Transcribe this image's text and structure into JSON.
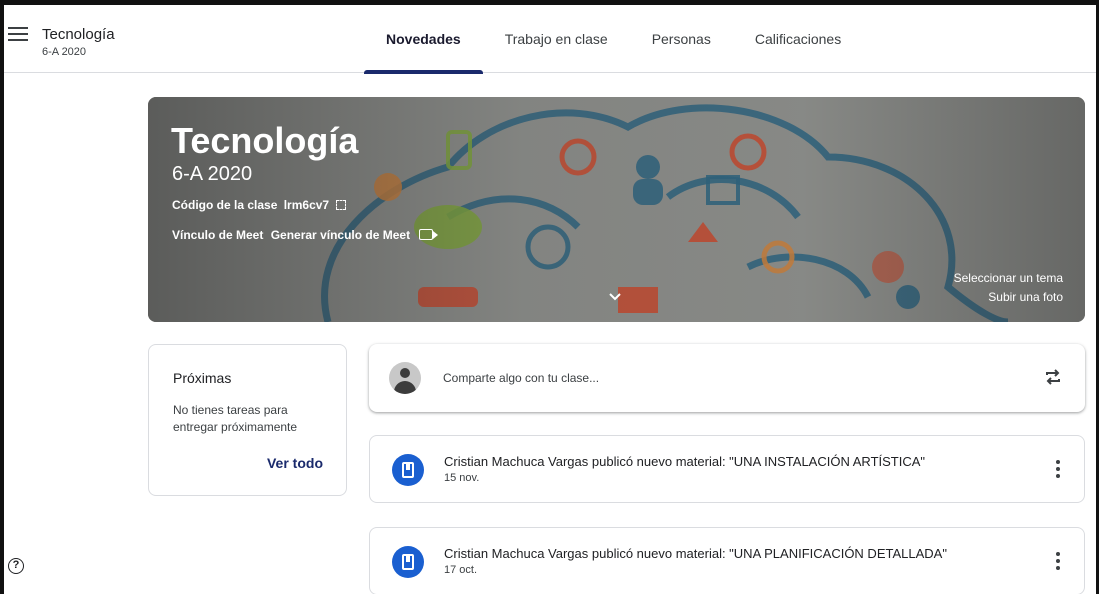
{
  "header": {
    "class_name": "Tecnología",
    "class_section": "6-A 2020",
    "tabs": [
      {
        "label": "Novedades",
        "active": true
      },
      {
        "label": "Trabajo en clase",
        "active": false
      },
      {
        "label": "Personas",
        "active": false
      },
      {
        "label": "Calificaciones",
        "active": false
      }
    ]
  },
  "banner": {
    "title": "Tecnología",
    "section": "6-A 2020",
    "code_label": "Código de la clase",
    "code_value": "lrm6cv7",
    "meet_label": "Vínculo de Meet",
    "meet_link": "Generar vínculo de Meet",
    "select_theme": "Seleccionar un tema",
    "upload_photo": "Subir una foto"
  },
  "upcoming": {
    "title": "Próximas",
    "text": "No tienes tareas para entregar próximamente",
    "link": "Ver todo"
  },
  "share": {
    "placeholder": "Comparte algo con tu clase..."
  },
  "posts": [
    {
      "title": "Cristian Machuca Vargas publicó nuevo material: \"UNA INSTALACIÓN ARTÍSTICA\"",
      "date": "15 nov."
    },
    {
      "title": "Cristian Machuca Vargas publicó nuevo material: \"UNA PLANIFICACIÓN DETALLADA\"",
      "date": "17 oct."
    }
  ],
  "icons": {
    "menu": "menu-icon",
    "fullscreen": "fullscreen-icon",
    "camera": "video-camera-icon",
    "chevron": "chevron-down-icon",
    "repost": "repost-icon",
    "material": "book-icon",
    "more": "more-vertical-icon",
    "help": "help-icon"
  },
  "colors": {
    "accent": "#1a2a6c",
    "post_icon": "#1a5fd0"
  }
}
